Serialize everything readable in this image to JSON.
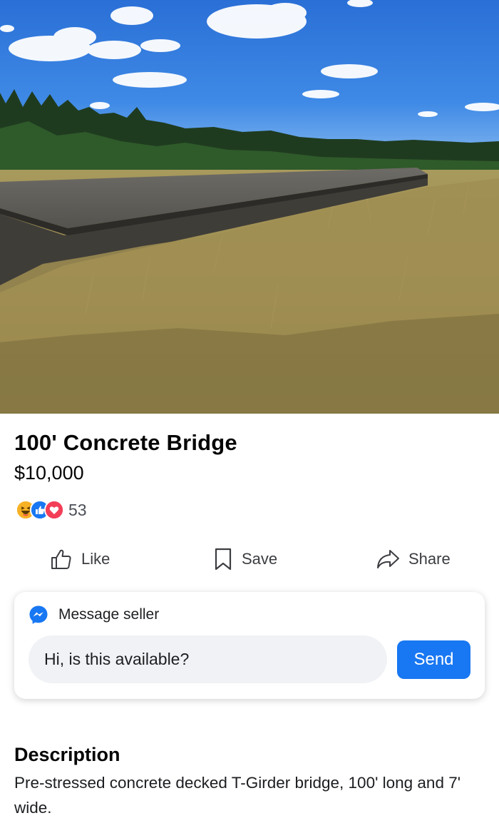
{
  "listing": {
    "title": "100' Concrete Bridge",
    "price": "$10,000"
  },
  "reactions": {
    "icons": [
      "haha-reaction-icon",
      "like-reaction-icon",
      "love-reaction-icon"
    ],
    "count": "53"
  },
  "actions": {
    "like_label": "Like",
    "save_label": "Save",
    "share_label": "Share"
  },
  "message": {
    "heading": "Message seller",
    "input_value": "Hi, is this available?",
    "send_label": "Send"
  },
  "description": {
    "heading": "Description",
    "body": "Pre-stressed concrete decked T-Girder bridge, 100' long and 7' wide."
  },
  "colors": {
    "accent": "#1877f2",
    "input_background": "#f0f2f5",
    "love": "#f33e58",
    "haha": "#f7b125"
  }
}
